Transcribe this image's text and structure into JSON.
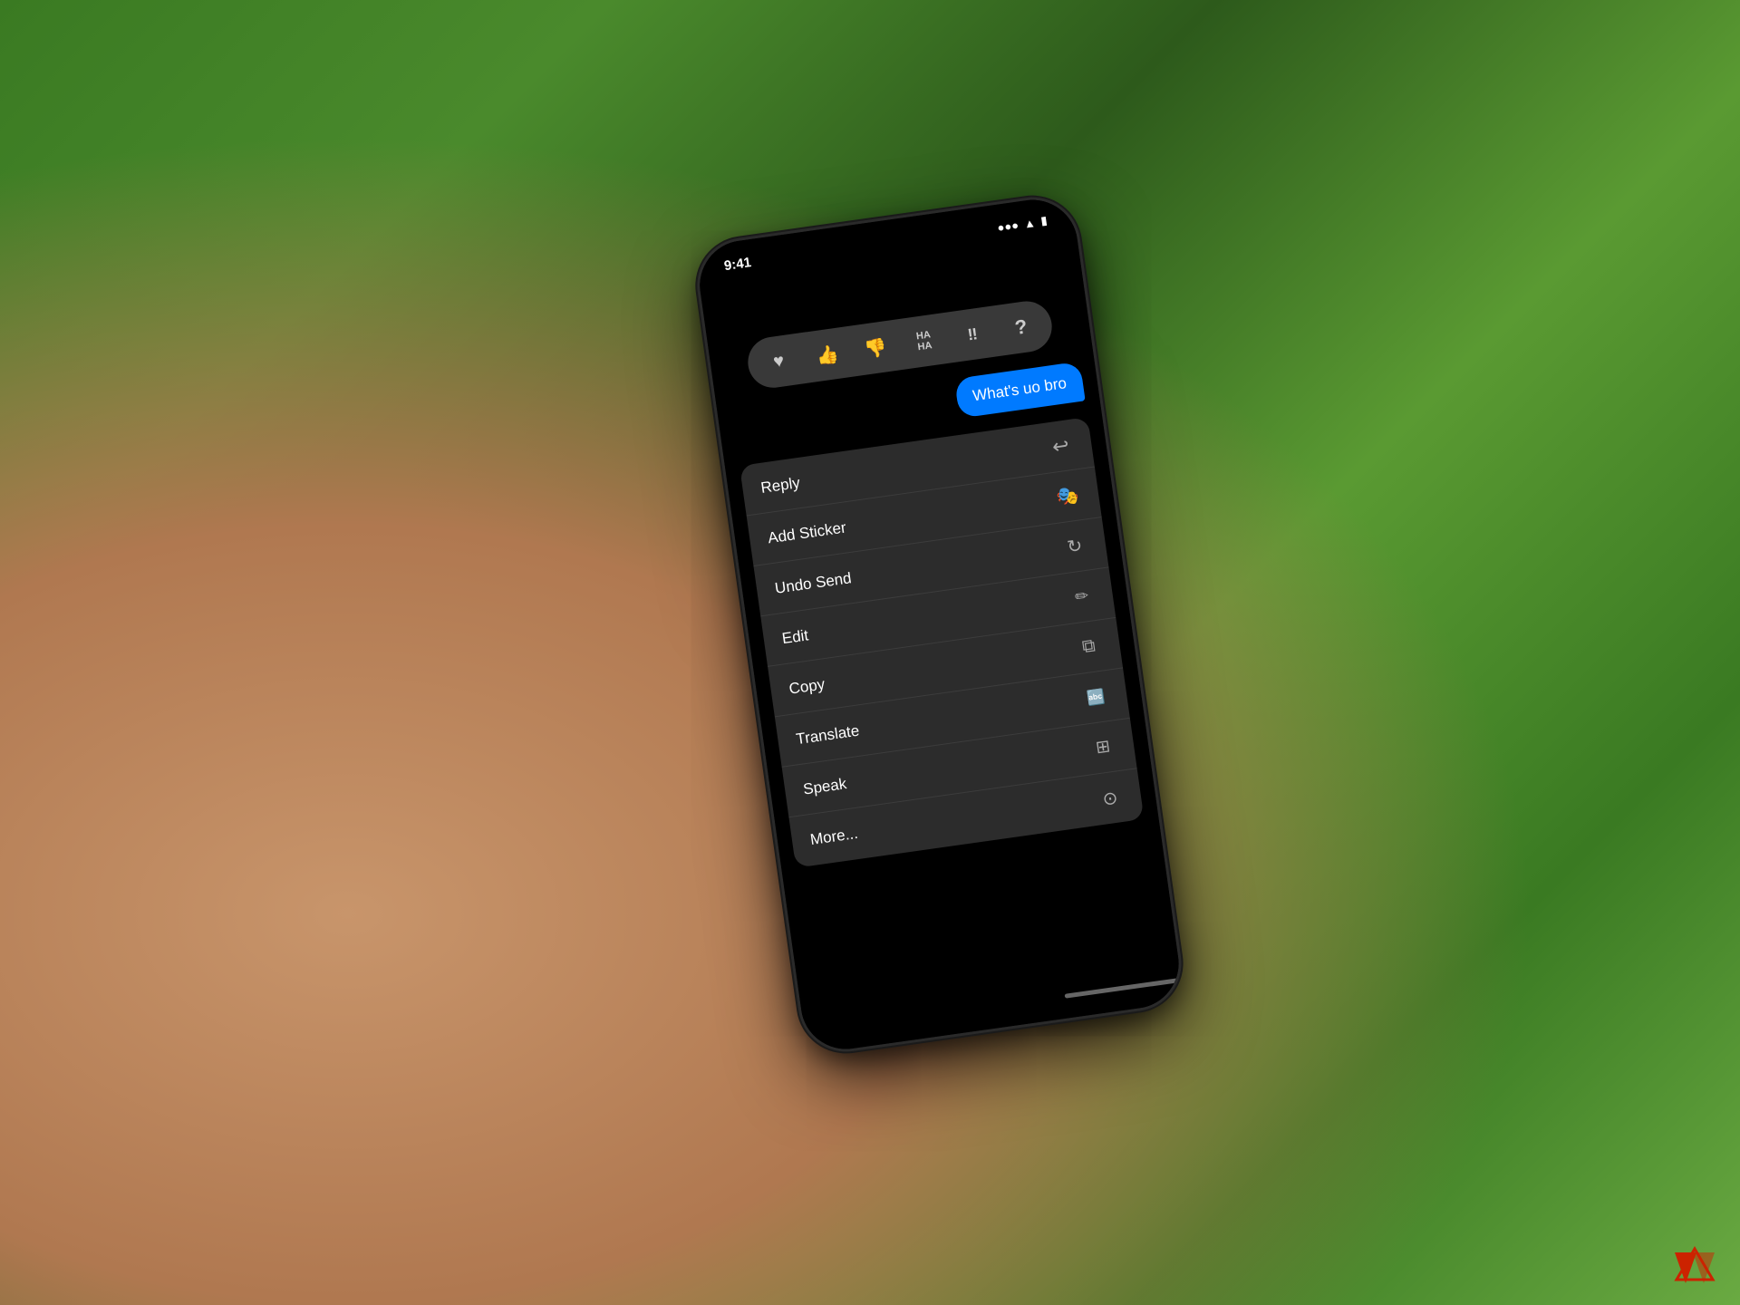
{
  "phone": {
    "message": {
      "text": "What's uo bro",
      "bubble_color": "#007AFF"
    },
    "reactions": [
      {
        "name": "heart",
        "icon": "♥",
        "label": "heart"
      },
      {
        "name": "thumbs-up",
        "icon": "👍",
        "label": "thumbs up"
      },
      {
        "name": "thumbs-down",
        "icon": "👎",
        "label": "thumbs down"
      },
      {
        "name": "haha",
        "icon": "HA\nHA",
        "label": "haha"
      },
      {
        "name": "exclaim",
        "icon": "‼",
        "label": "emphasize"
      },
      {
        "name": "question",
        "icon": "?",
        "label": "question"
      }
    ],
    "context_menu": {
      "items": [
        {
          "label": "Reply",
          "icon": "↩",
          "name": "reply"
        },
        {
          "label": "Add Sticker",
          "icon": "⊕",
          "name": "add-sticker"
        },
        {
          "label": "Undo Send",
          "icon": "↻",
          "name": "undo-send"
        },
        {
          "label": "Edit",
          "icon": "✏",
          "name": "edit"
        },
        {
          "label": "Copy",
          "icon": "⧉",
          "name": "copy"
        },
        {
          "label": "Translate",
          "icon": "⚡",
          "name": "translate"
        },
        {
          "label": "Speak",
          "icon": "⊞",
          "name": "speak"
        },
        {
          "label": "More...",
          "icon": "…",
          "name": "more"
        }
      ]
    }
  },
  "ap_logo": {
    "visible": true
  }
}
